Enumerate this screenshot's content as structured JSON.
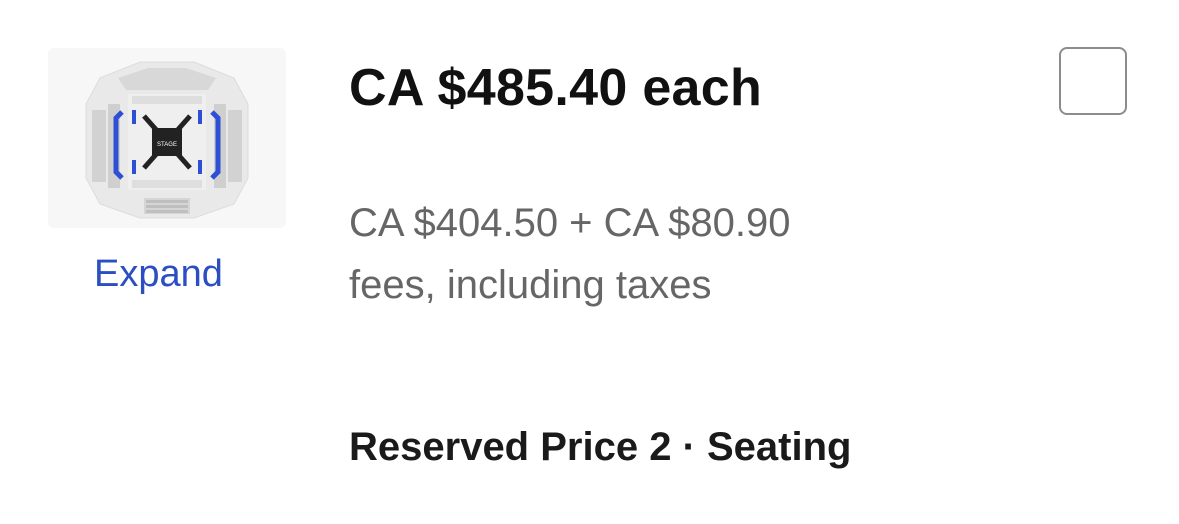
{
  "listing": {
    "price_each": "CA $485.40 each",
    "breakdown_line1": "CA $404.50 + CA $80.90",
    "breakdown_line2": "fees, including taxes",
    "section": "Reserved Price 2 · Seating"
  },
  "map": {
    "stage_label": "STAGE",
    "expand_label": "Expand",
    "highlight_color": "#2d4fd6"
  },
  "select": {
    "checked": false
  }
}
